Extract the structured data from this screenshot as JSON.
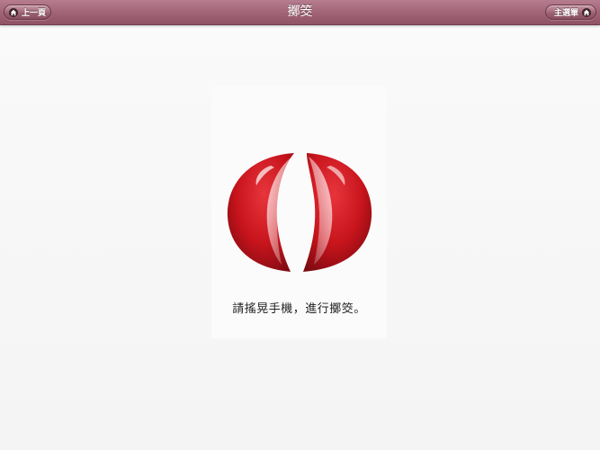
{
  "header": {
    "title": "擲筊",
    "back_label": "上一頁",
    "home_label": "主選單",
    "back_icon": "home-icon",
    "home_icon": "home-icon"
  },
  "main": {
    "instruction": "請搖晃手機，進行擲筊。",
    "image_icon": "moon-blocks-icon"
  },
  "colors": {
    "nav_bar": "#a06375",
    "block_red": "#c8141c",
    "background": "#f7f7f7"
  }
}
